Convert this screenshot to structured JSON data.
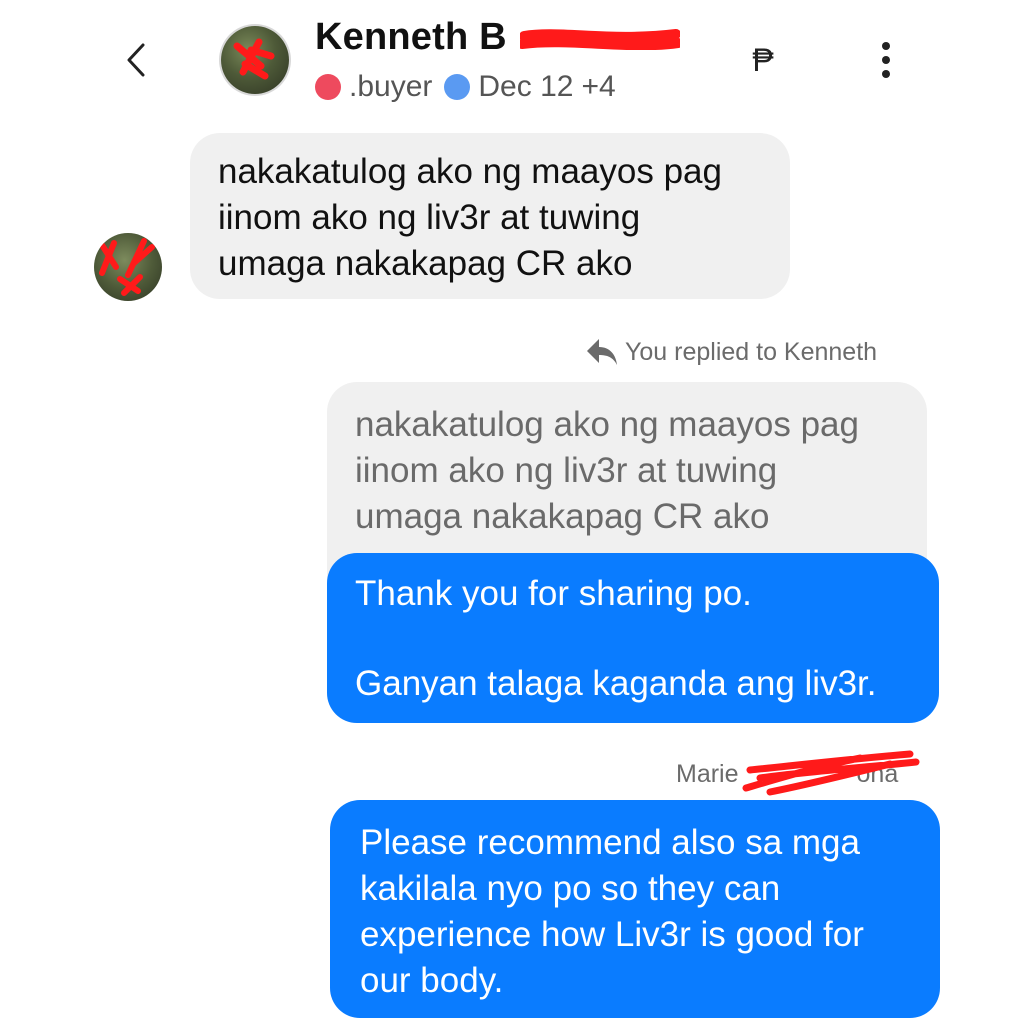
{
  "header": {
    "back_icon": "chevron-left-icon",
    "contact_name": "Kenneth B",
    "status": {
      "dot1_color": "#ee4a5e",
      "label": ".buyer",
      "dot2_color": "#5a9af2",
      "date": "Dec 12",
      "extra": "+4"
    },
    "peso_icon": "₱",
    "more_icon": "more-vertical-icon"
  },
  "messages": {
    "incoming": {
      "lines": [
        "nakakatulog ako ng maayos pag",
        "iinom ako ng liv3r at tuwing",
        "umaga nakakapag CR ako"
      ]
    },
    "reply_note": "You replied to Kenneth",
    "quoted": {
      "lines": [
        "nakakatulog ako ng maayos pag",
        "iinom ako ng liv3r at tuwing",
        "umaga nakakapag CR ako"
      ]
    },
    "outgoing_1": {
      "line1": "Thank you for sharing po.",
      "line2": "Ganyan talaga kaganda ang liv3r."
    },
    "sender_label": "Marie",
    "sender_label_tail": "ona",
    "outgoing_2": {
      "lines": [
        "Please recommend also sa mga",
        "kakilala nyo po so they can",
        "experience how Liv3r is good for",
        "our body."
      ]
    }
  },
  "colors": {
    "outgoing_bubble": "#0a7cff",
    "incoming_bubble": "#f0f0f0",
    "redaction": "#ff1a1a"
  }
}
